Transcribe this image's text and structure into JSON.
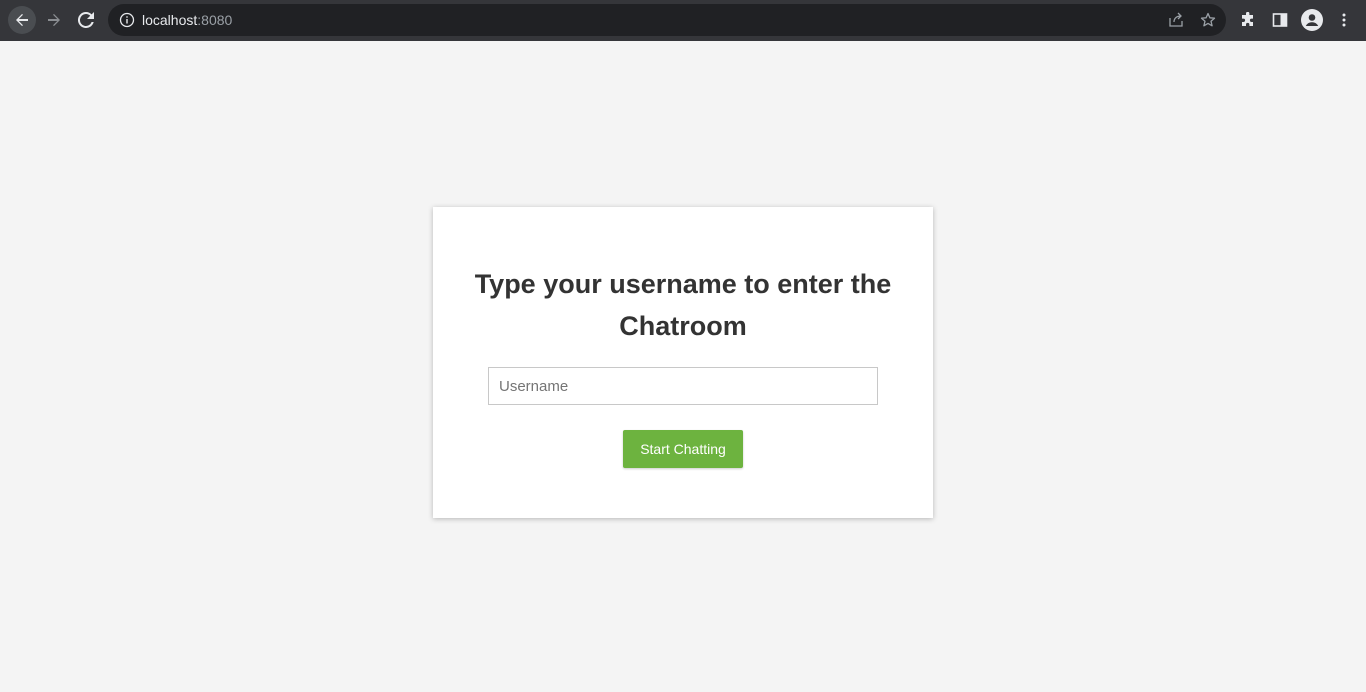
{
  "browser": {
    "url_host": "localhost",
    "url_port": ":8080",
    "icons": {
      "back": "arrow-left-icon",
      "forward": "arrow-right-icon",
      "reload": "reload-icon",
      "site_info": "info-icon",
      "share": "share-icon",
      "bookmark": "star-icon",
      "extensions": "puzzle-icon",
      "side_panel": "side-panel-icon",
      "profile": "profile-icon",
      "menu": "kebab-menu-icon"
    }
  },
  "login": {
    "title": "Type your username to enter the Chatroom",
    "username_placeholder": "Username",
    "username_value": "",
    "submit_label": "Start Chatting"
  },
  "colors": {
    "page_background": "#f4f4f4",
    "toolbar": "#35363a",
    "button": "#6db33f",
    "title_text": "#333333"
  }
}
